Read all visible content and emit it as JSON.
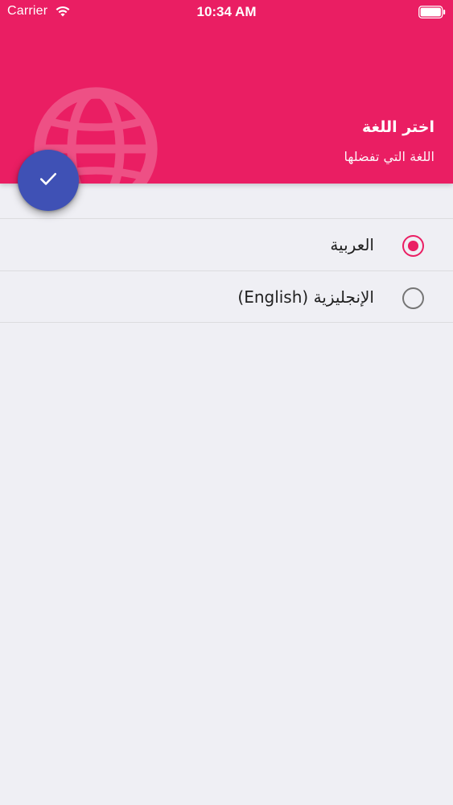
{
  "status_bar": {
    "carrier": "Carrier",
    "time": "10:34 AM",
    "wifi_icon": "wifi-icon",
    "battery_icon": "battery-icon"
  },
  "header": {
    "title": "اختر اللغة",
    "subtitle": "اللغة التي تفضلها",
    "background_color": "#ea1e63",
    "decor_icon": "globe-icon"
  },
  "fab": {
    "icon": "check-icon",
    "color": "#3f51b5"
  },
  "languages": {
    "selected_index": 0,
    "items": [
      {
        "label": "العربية",
        "selected": true
      },
      {
        "label": "الإنجليزية (English)",
        "selected": false
      }
    ]
  },
  "colors": {
    "accent": "#ea1e63",
    "fab": "#3f51b5",
    "background": "#efeff4"
  }
}
